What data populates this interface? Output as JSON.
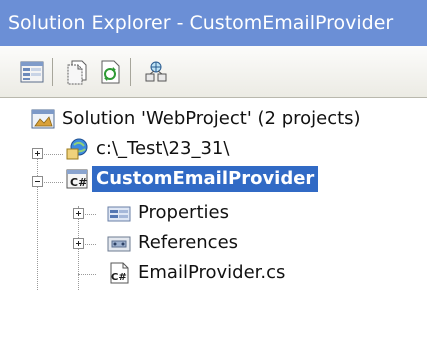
{
  "window": {
    "title": "Solution Explorer - CustomEmailProvider"
  },
  "toolbar": {
    "buttons": [
      {
        "name": "Properties",
        "icon": "properties-icon"
      },
      {
        "name": "Show All Files",
        "icon": "show-all-files-icon"
      },
      {
        "name": "Refresh",
        "icon": "refresh-icon"
      },
      {
        "name": "Copy Web Site",
        "icon": "copy-web-site-icon"
      }
    ]
  },
  "tree": {
    "solution_label": "Solution 'WebProject' (2 projects)",
    "website_label": "c:\\_Test\\23_31\\",
    "project_label": "CustomEmailProvider",
    "properties_label": "Properties",
    "references_label": "References",
    "file_label": "EmailProvider.cs"
  },
  "colors": {
    "title_bar": "#6b8fd6",
    "selection": "#316ac5"
  }
}
